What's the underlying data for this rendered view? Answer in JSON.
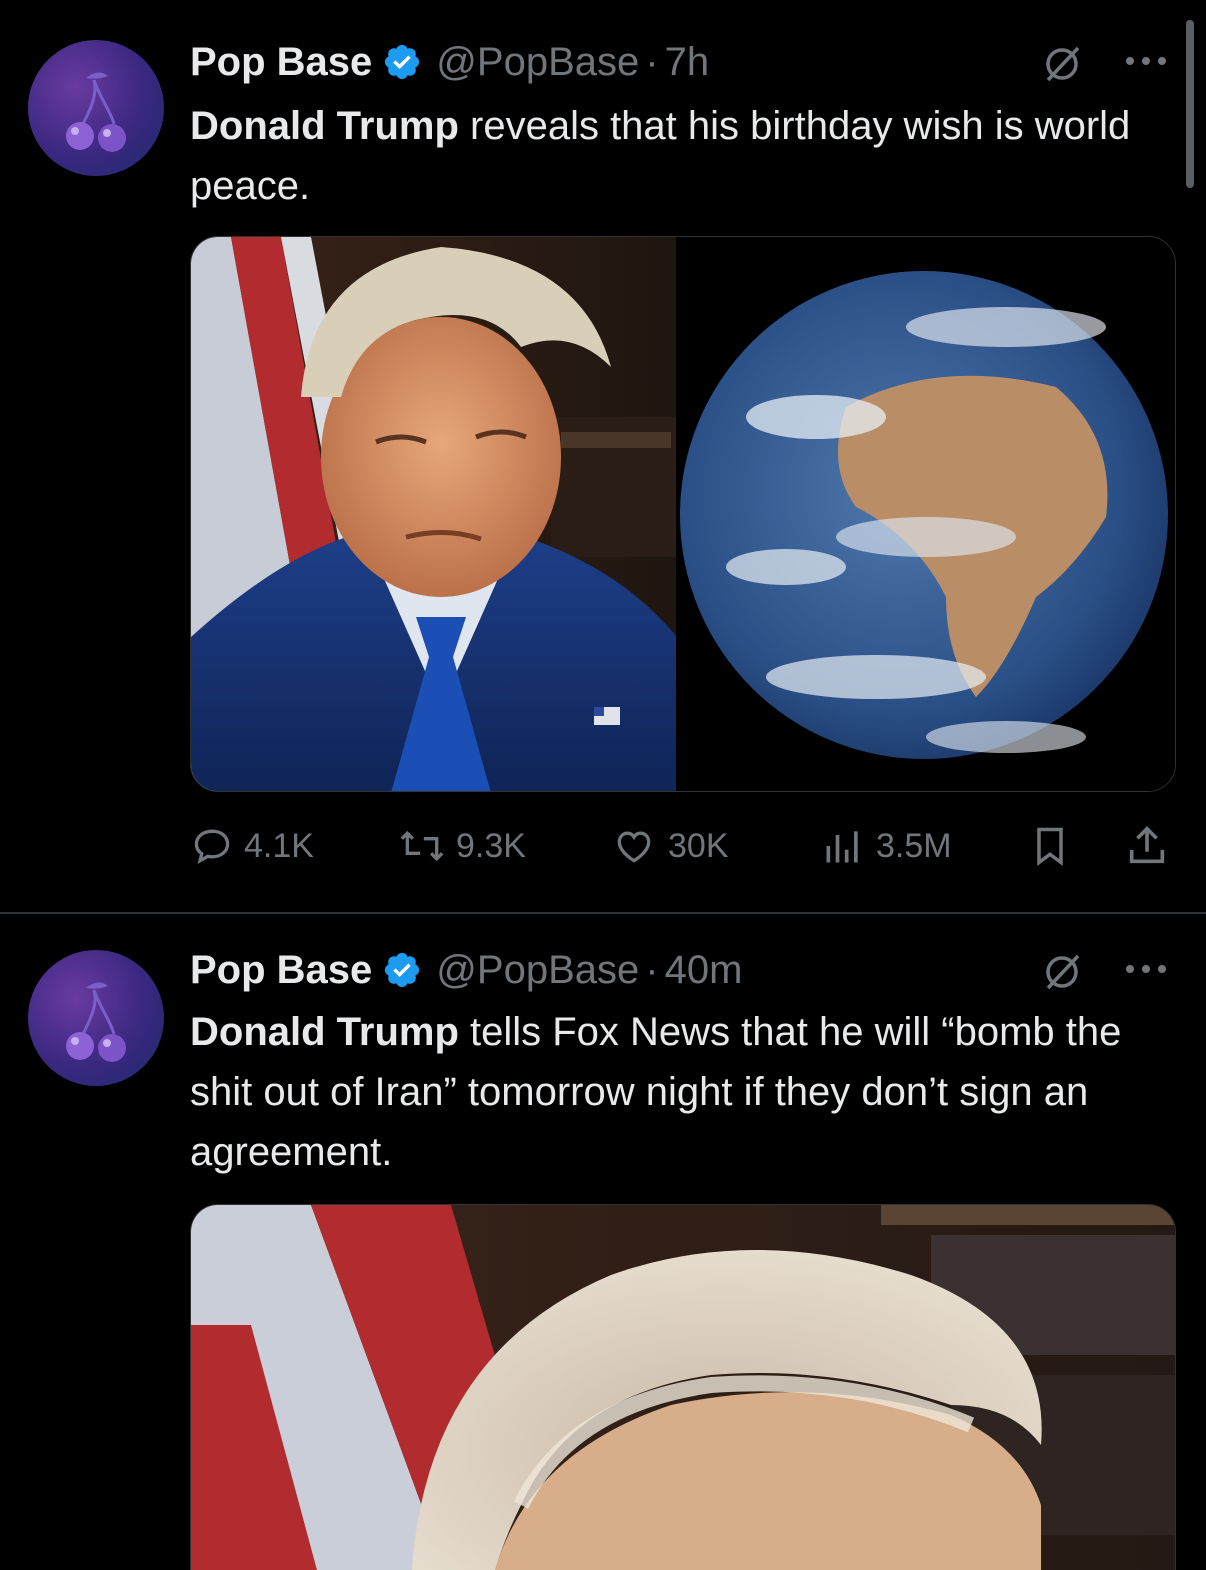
{
  "colors": {
    "background": "#000000",
    "text_primary": "#e7e9ea",
    "text_secondary": "#71767b",
    "verified": "#1d9bf0",
    "divider": "#2f3336"
  },
  "tweets": [
    {
      "author": "Pop Base",
      "handle": "@PopBase",
      "separator": "·",
      "time": "7h",
      "text_bold": "Donald Trump",
      "text_rest": " reveals that his birthday wish is world peace.",
      "media": [
        "Donald Trump portrait",
        "Earth from space"
      ],
      "stats": {
        "replies": "4.1K",
        "reposts": "9.3K",
        "likes": "30K",
        "views": "3.5M"
      },
      "icons": [
        "avatar-cherry-icon",
        "verified-badge-icon",
        "grok-icon",
        "more-icon",
        "reply-icon",
        "repost-icon",
        "like-icon",
        "views-icon",
        "bookmark-icon",
        "share-icon"
      ]
    },
    {
      "author": "Pop Base",
      "handle": "@PopBase",
      "separator": "·",
      "time": "40m",
      "text_bold": "Donald Trump",
      "text_rest": " tells Fox News that he will “bomb the shit out of Iran” tomorrow night if they don’t sign an agreement.",
      "media": [
        "Donald Trump portrait (cropped)"
      ]
    }
  ]
}
